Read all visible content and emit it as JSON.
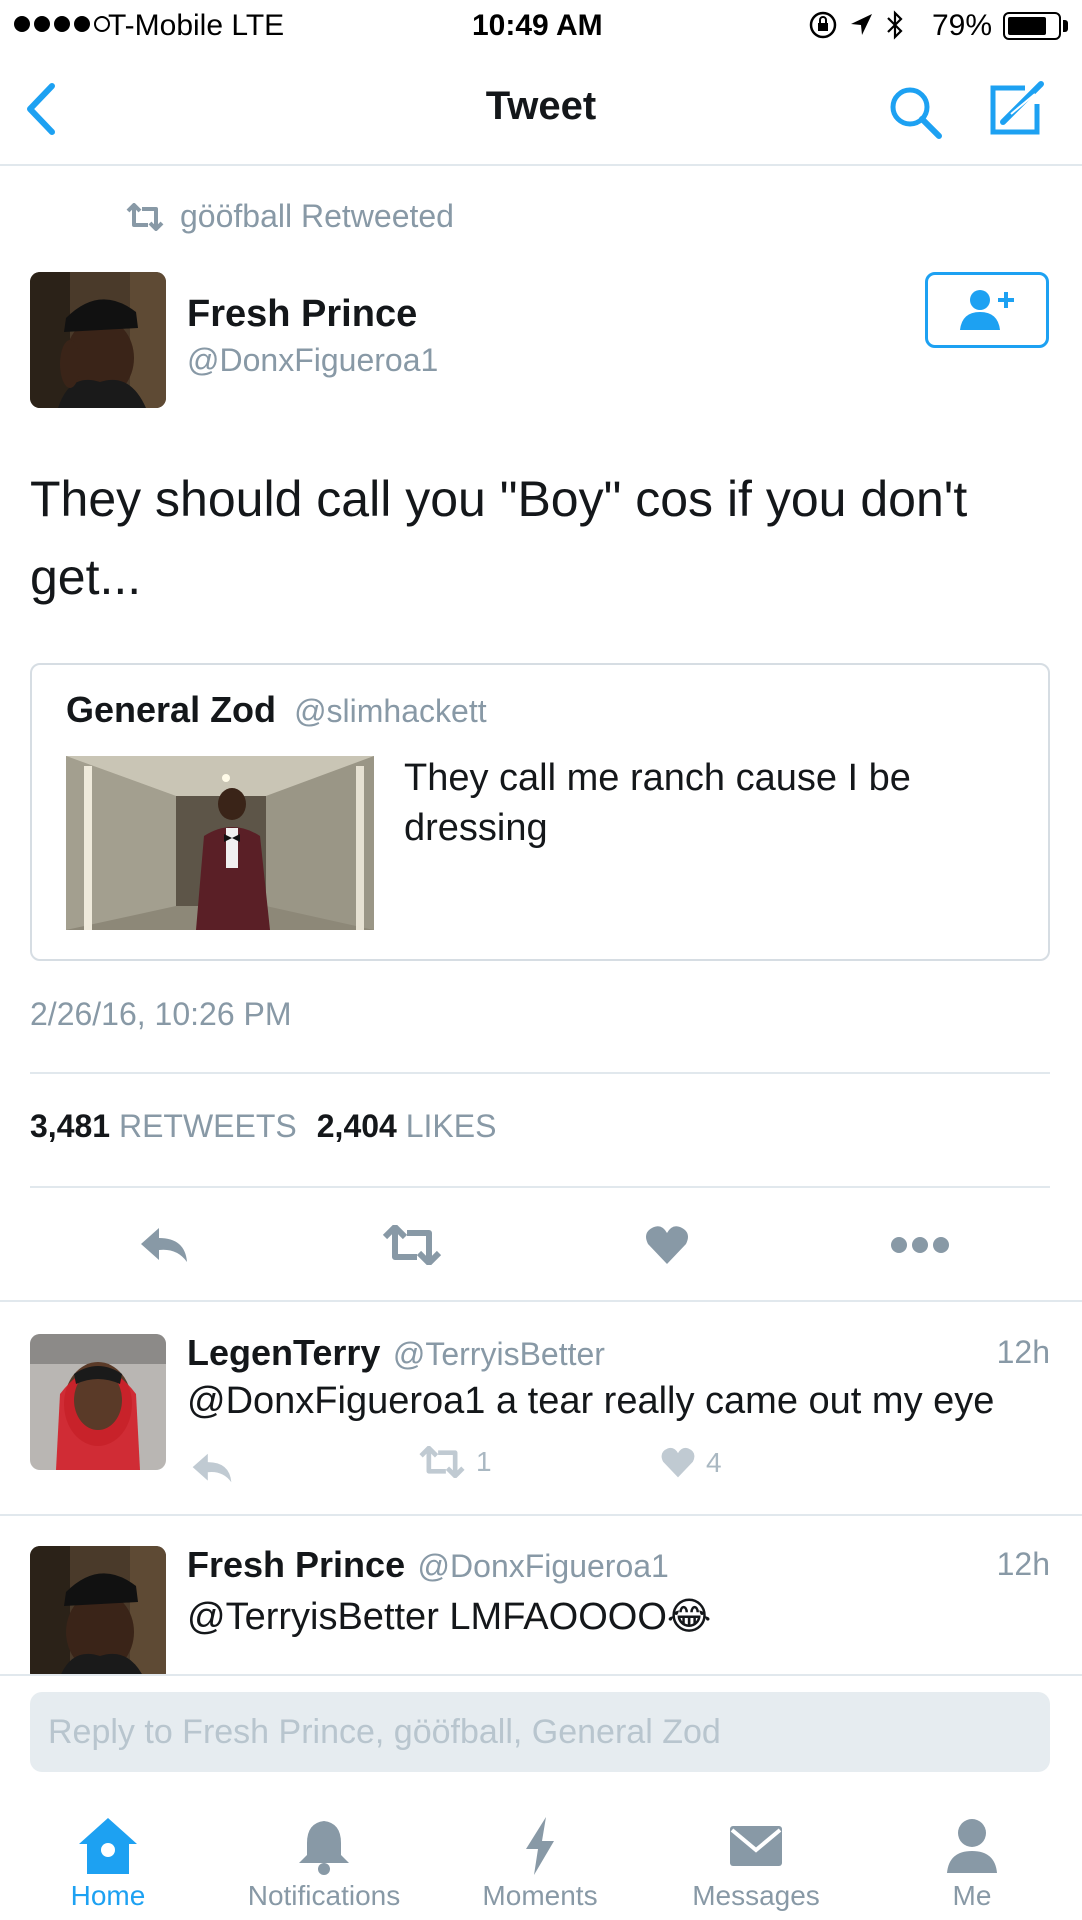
{
  "status_bar": {
    "carrier": "T-Mobile  LTE",
    "time": "10:49 AM",
    "battery": "79%",
    "battery_level": 0.79
  },
  "nav": {
    "title": "Tweet"
  },
  "tweet": {
    "retweeted_by": "gööfball Retweeted",
    "author_name": "Fresh Prince",
    "author_handle": "@DonxFigueroa1",
    "text": "They should call you \"Boy\" cos if you don't get...",
    "quoted": {
      "author_name": "General Zod",
      "author_handle": "@slimhackett",
      "text": "They call me ranch cause I be dressing"
    },
    "timestamp": "2/26/16, 10:26 PM",
    "retweets_count": "3,481",
    "retweets_label": "RETWEETS",
    "likes_count": "2,404",
    "likes_label": "LIKES"
  },
  "replies": [
    {
      "name": "LegenTerry",
      "handle": "@TerryisBetter",
      "time": "12h",
      "text": "@DonxFigueroa1 a tear really came out my eye",
      "retweets": "1",
      "likes": "4"
    },
    {
      "name": "Fresh Prince",
      "handle": "@DonxFigueroa1",
      "time": "12h",
      "text": "@TerryisBetter LMFAOOOO",
      "emoji": "😂"
    }
  ],
  "reply_box": {
    "placeholder": "Reply to Fresh Prince, gööfball, General Zod"
  },
  "tabs": [
    {
      "label": "Home",
      "icon": "home-icon",
      "active": true
    },
    {
      "label": "Notifications",
      "icon": "bell-icon"
    },
    {
      "label": "Moments",
      "icon": "lightning-icon"
    },
    {
      "label": "Messages",
      "icon": "envelope-icon"
    },
    {
      "label": "Me",
      "icon": "person-icon"
    }
  ],
  "colors": {
    "accent": "#1da1f2",
    "secondary_text": "#8899a6",
    "action_icon": "#8899a6",
    "divider": "#e1e8ed"
  }
}
